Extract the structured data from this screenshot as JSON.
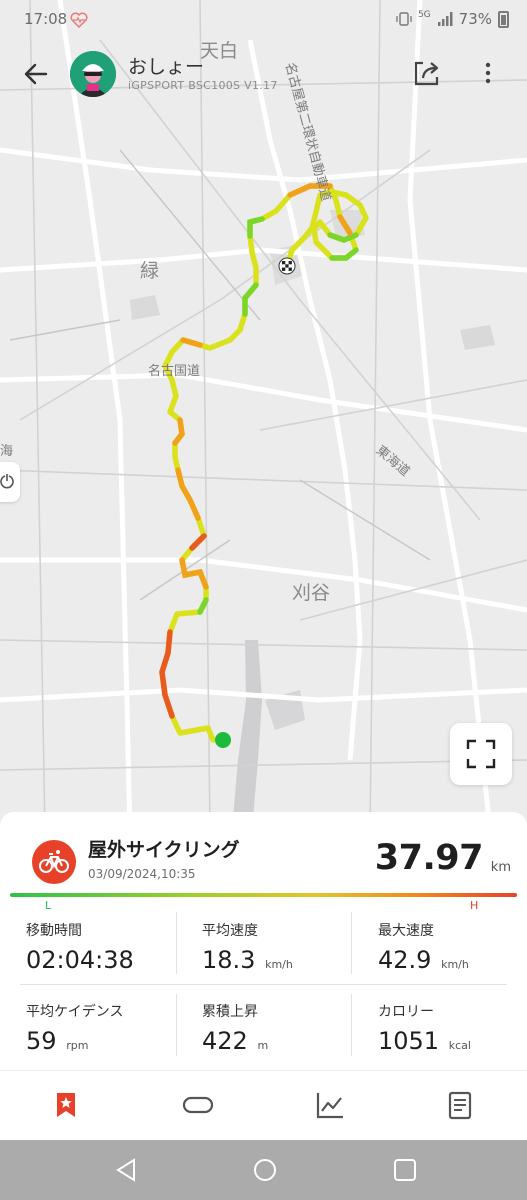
{
  "status_bar": {
    "time": "17:08",
    "network": "5G",
    "battery": "73%"
  },
  "header": {
    "user_name": "おしょー",
    "device": "iGPSPORT BSC100S  V1.17"
  },
  "map": {
    "labels": {
      "tenpaku": "天白",
      "midori": "緑",
      "kariya": "刈谷",
      "nishi_sliver": "海",
      "nagoya_second_ring": "名古屋第二環状自動車道",
      "nagoya_kokudo": "名古国道",
      "tokaido": "東海道"
    },
    "route_colors": [
      "#7bd62a",
      "#d6e21e",
      "#f0a21a",
      "#e95a1e"
    ],
    "start_color": "#1dbb3c"
  },
  "activity": {
    "type": "屋外サイクリング",
    "date": "03/09/2024,10:35",
    "distance": "37.97",
    "distance_unit": "km",
    "gradient_low": "L",
    "gradient_high": "H"
  },
  "stats": [
    {
      "label": "移動時間",
      "value": "02:04:38",
      "unit": ""
    },
    {
      "label": "平均速度",
      "value": "18.3",
      "unit": "km/h"
    },
    {
      "label": "最大速度",
      "value": "42.9",
      "unit": "km/h"
    },
    {
      "label": "平均ケイデンス",
      "value": "59",
      "unit": "rpm"
    },
    {
      "label": "累積上昇",
      "value": "422",
      "unit": "m"
    },
    {
      "label": "カロリー",
      "value": "1051",
      "unit": "kcal"
    }
  ],
  "colors": {
    "accent": "#e8412a",
    "gradient_low": "#2fc24a"
  },
  "tabs": [
    {
      "icon": "bookmark-star-icon",
      "active": true
    },
    {
      "icon": "lap-icon",
      "active": false
    },
    {
      "icon": "chart-icon",
      "active": false
    },
    {
      "icon": "document-icon",
      "active": false
    }
  ]
}
